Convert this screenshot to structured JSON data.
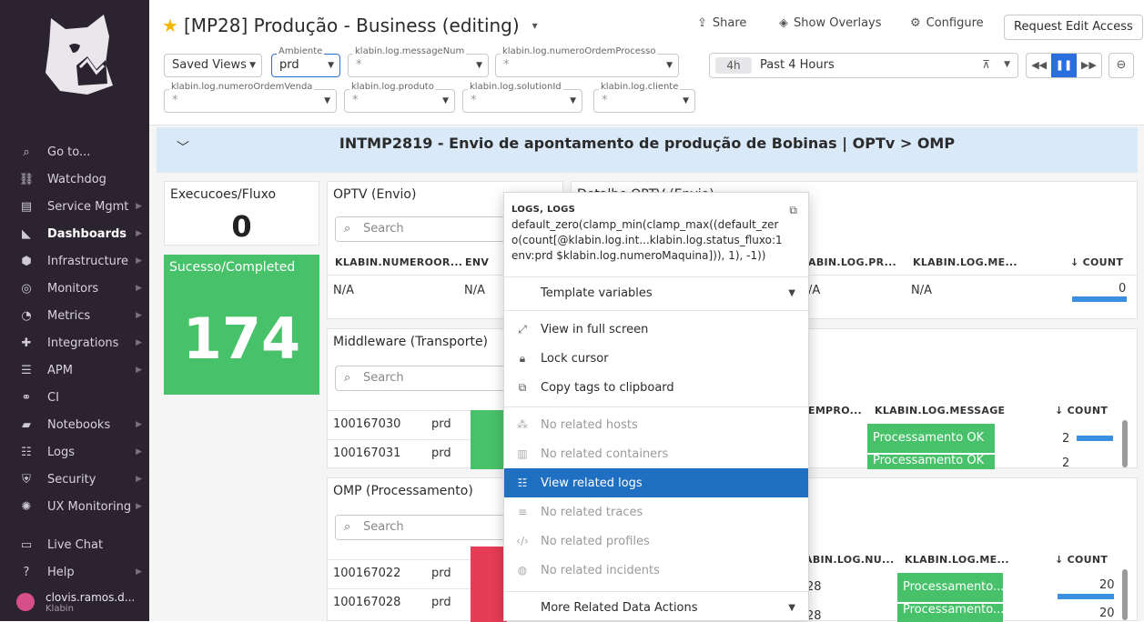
{
  "sidebar": {
    "items": [
      {
        "label": "Go to...",
        "icon": "search-icon",
        "chev": false
      },
      {
        "label": "Watchdog",
        "icon": "binoculars-icon",
        "chev": false
      },
      {
        "label": "Service Mgmt",
        "icon": "service-icon",
        "chev": true
      },
      {
        "label": "Dashboards",
        "icon": "chart-icon",
        "chev": true
      },
      {
        "label": "Infrastructure",
        "icon": "hexagons-icon",
        "chev": true
      },
      {
        "label": "Monitors",
        "icon": "radar-icon",
        "chev": true
      },
      {
        "label": "Metrics",
        "icon": "gauge-icon",
        "chev": true
      },
      {
        "label": "Integrations",
        "icon": "puzzle-icon",
        "chev": true
      },
      {
        "label": "APM",
        "icon": "apm-icon",
        "chev": true
      },
      {
        "label": "CI",
        "icon": "ci-icon",
        "chev": false
      },
      {
        "label": "Notebooks",
        "icon": "notebook-icon",
        "chev": true
      },
      {
        "label": "Logs",
        "icon": "logs-icon",
        "chev": true
      },
      {
        "label": "Security",
        "icon": "shield-icon",
        "chev": true
      },
      {
        "label": "UX Monitoring",
        "icon": "ux-icon",
        "chev": true
      }
    ],
    "bottom": [
      {
        "label": "Live Chat",
        "icon": "chat-icon"
      },
      {
        "label": "Help",
        "icon": "help-icon"
      }
    ],
    "user": {
      "name": "clovis.ramos.d...",
      "org": "Klabin"
    }
  },
  "header": {
    "title": "[MP28] Produção - Business (editing)",
    "share": "Share",
    "overlays": "Show Overlays",
    "configure": "Configure",
    "request": "Request Edit Access",
    "saved_views": "Saved Views",
    "vars_row1": [
      {
        "label": "Ambiente",
        "value": "prd"
      },
      {
        "label": "klabin.log.messageNum",
        "value": "*"
      },
      {
        "label": "klabin.log.numeroOrdemProcesso",
        "value": "*"
      }
    ],
    "vars_row2": [
      {
        "label": "klabin.log.numeroOrdemVenda",
        "value": "*"
      },
      {
        "label": "klabin.log.produto",
        "value": "*"
      },
      {
        "label": "klabin.log.solutionId",
        "value": "*"
      },
      {
        "label": "klabin.log.cliente",
        "value": "*"
      }
    ],
    "time_badge": "4h",
    "time_label": "Past 4 Hours"
  },
  "group_title": "INTMP2819 - Envio de apontamento de produção de Bobinas | OPTv > OMP",
  "widgets": {
    "execucoes_title": "Execucoes/Fluxo",
    "execucoes_value": "0",
    "sucesso_title": "Sucesso/Completed",
    "sucesso_value": "174",
    "optv_title": "OPTV (Envio)",
    "detail_title": "Detalhe OPTV (Envio)",
    "search_placeholder": "Search",
    "optv_cols": [
      "KLABIN.NUMEROOR...",
      "ENV"
    ],
    "optv_row": [
      "N/A",
      "N/A"
    ],
    "detail_cols": [
      "ABIN.LOG.PR...",
      "KLABIN.LOG.ME...",
      "COUNT"
    ],
    "detail_row": [
      "/A",
      "N/A",
      "0"
    ],
    "mw_title": "Middleware (Transporte)",
    "mw_rows": [
      [
        "100167030",
        "prd"
      ],
      [
        "100167031",
        "prd"
      ]
    ],
    "mw_cols": [
      "EMPRO...",
      "KLABIN.LOG.MESSAGE",
      "COUNT"
    ],
    "mw_right": [
      {
        "msg": "Processamento OK",
        "count": "2"
      },
      {
        "msg": "Processamento OK",
        "count": "2"
      }
    ],
    "omp_title": "OMP (Processamento)",
    "omp_rows": [
      [
        "100167022",
        "prd"
      ],
      [
        "100167028",
        "prd"
      ]
    ],
    "omp_cols": [
      "ABIN.LOG.NU...",
      "KLABIN.LOG.ME...",
      "COUNT"
    ],
    "omp_right": [
      {
        "num": "28",
        "msg": "Processamento...",
        "count": "20"
      },
      {
        "num": "28",
        "msg": "Processamento...",
        "count": "20"
      }
    ]
  },
  "menu": {
    "heading": "LOGS, LOGS",
    "query": "default_zero(clamp_min(clamp_max((default_zero(count[@klabin.log.int...klabin.log.status_fluxo:1 env:prd $klabin.log.numeroMaquina])), 1), -1))",
    "template_vars": "Template variables",
    "items": [
      {
        "label": "View in full screen",
        "icon": "fullscreen-icon",
        "disabled": false,
        "hl": false
      },
      {
        "label": "Lock cursor",
        "icon": "lock-icon",
        "disabled": false,
        "hl": false
      },
      {
        "label": "Copy tags to clipboard",
        "icon": "copy-icon",
        "disabled": false,
        "hl": false
      },
      {
        "label": "No related hosts",
        "icon": "hosts-icon",
        "disabled": true,
        "hl": false
      },
      {
        "label": "No related containers",
        "icon": "containers-icon",
        "disabled": true,
        "hl": false
      },
      {
        "label": "View related logs",
        "icon": "logs-icon",
        "disabled": false,
        "hl": true
      },
      {
        "label": "No related traces",
        "icon": "traces-icon",
        "disabled": true,
        "hl": false
      },
      {
        "label": "No related profiles",
        "icon": "profiles-icon",
        "disabled": true,
        "hl": false
      },
      {
        "label": "No related incidents",
        "icon": "incidents-icon",
        "disabled": true,
        "hl": false
      }
    ],
    "more": "More Related Data Actions"
  }
}
